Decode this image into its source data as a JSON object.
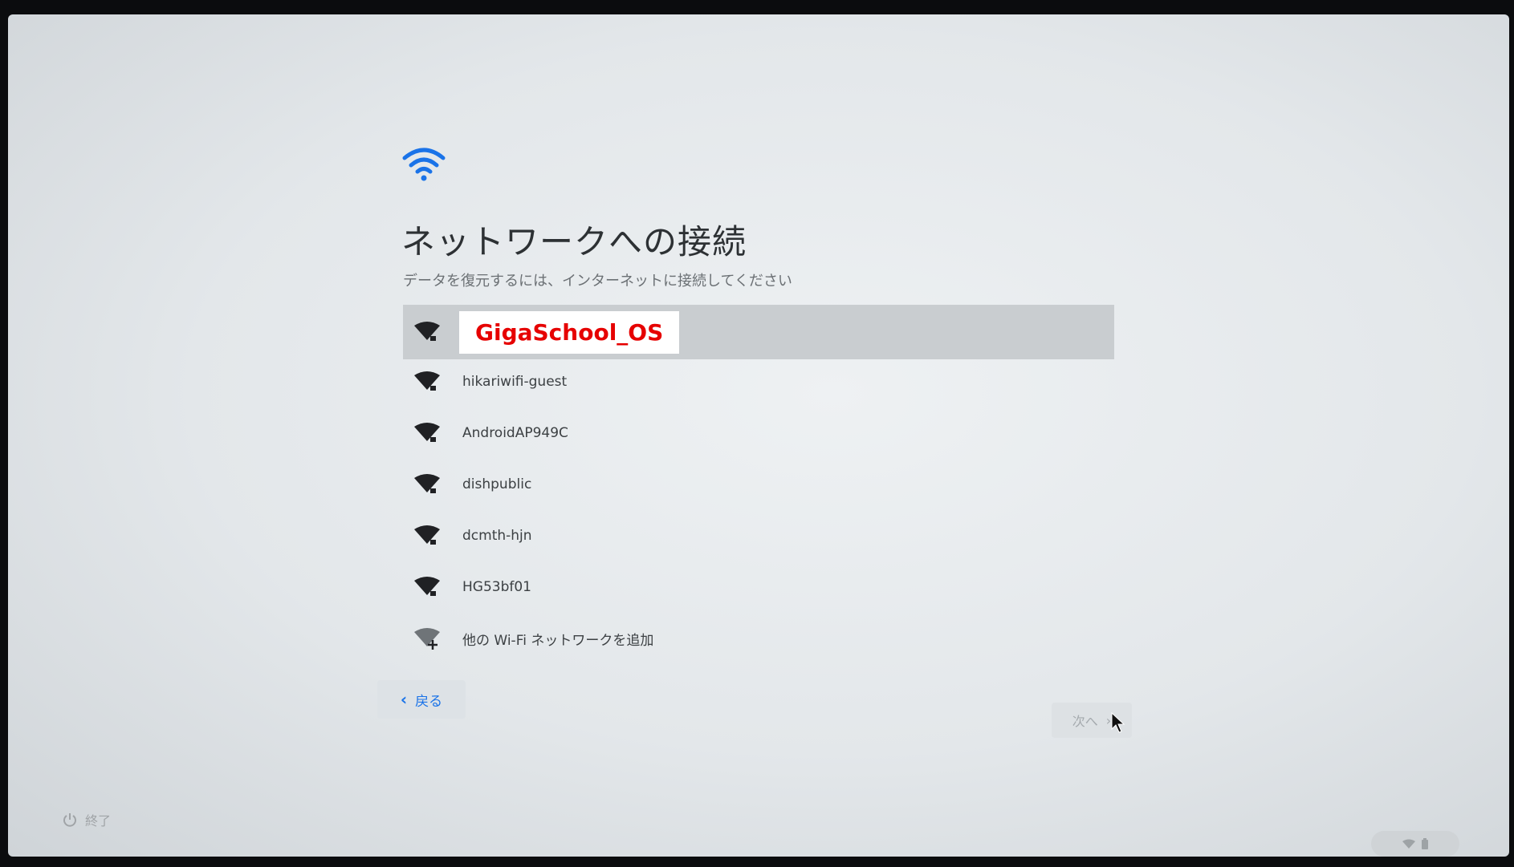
{
  "header": {
    "icon": "wifi-icon",
    "title": "ネットワークへの接続",
    "subtitle": "データを復元するには、インターネットに接続してください"
  },
  "networks": [
    {
      "name": "GigaSchool_OS",
      "icon": "wifi-lock-icon",
      "selected": true
    },
    {
      "name": "hikariwifi-guest",
      "icon": "wifi-lock-icon"
    },
    {
      "name": "AndroidAP949C",
      "icon": "wifi-lock-icon"
    },
    {
      "name": "dishpublic",
      "icon": "wifi-lock-icon"
    },
    {
      "name": "dcmth-hjn",
      "icon": "wifi-lock-icon"
    },
    {
      "name": "HG53bf01",
      "icon": "wifi-lock-icon"
    },
    {
      "name": "他の Wi-Fi ネットワークを追加",
      "icon": "wifi-add-icon"
    }
  ],
  "footer": {
    "back_label": "戻る",
    "next_label": "次へ",
    "shutdown_label": "終了"
  },
  "colors": {
    "accent": "#1a73e8",
    "highlight_text": "#e60000",
    "selected_row": "#c9cdd0"
  }
}
